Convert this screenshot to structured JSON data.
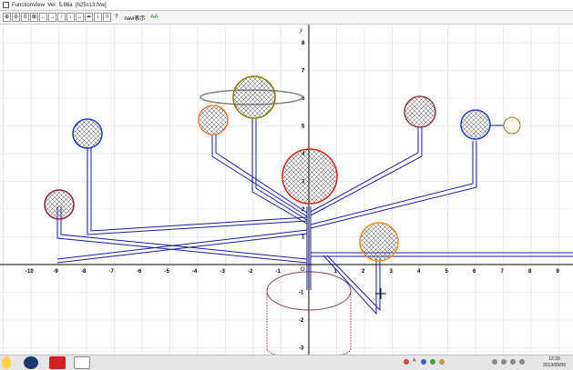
{
  "window": {
    "title": "FunctionView  Ver  5.86a  [h25s13.fvw]"
  },
  "toolbar": {
    "icons": [
      "zoom-in-icon",
      "zoom-out-icon",
      "zero-icon",
      "fit-icon",
      "move-left-icon",
      "move-right-icon",
      "move-up-icon",
      "move-down-icon",
      "expand-h-icon",
      "shrink-h-icon",
      "expand-v-icon",
      "shrink-v-icon"
    ],
    "zero_label": "0",
    "help_label": "?",
    "navi_label": "navi表示",
    "font_label": "AA"
  },
  "graph": {
    "y_axis_label": "y",
    "origin_label": "O",
    "x_tick_labels": [
      "-10",
      "-9",
      "-8",
      "-7",
      "-6",
      "-5",
      "-4",
      "-3",
      "-2",
      "-1",
      "1",
      "2",
      "3",
      "4",
      "5",
      "6",
      "7",
      "8",
      "9"
    ],
    "y_tick_labels": [
      "8",
      "7",
      "6",
      "5",
      "4",
      "3",
      "2",
      "1",
      "-1",
      "-2",
      "-3"
    ],
    "colors": {
      "grid": "#dddddd",
      "axis": "#000000",
      "branch": "#1a1aa0",
      "ring": "#808080"
    },
    "balls": [
      {
        "id": "red-large",
        "color": "#e02020"
      },
      {
        "id": "olive",
        "color": "#808000"
      },
      {
        "id": "orange-upper",
        "color": "#f08040"
      },
      {
        "id": "brown",
        "color": "#904040"
      },
      {
        "id": "blue-right",
        "color": "#2040c0"
      },
      {
        "id": "yellow",
        "color": "#d8c870"
      },
      {
        "id": "blue-left",
        "color": "#2040c0"
      },
      {
        "id": "maroon",
        "color": "#902040"
      },
      {
        "id": "orange-lower",
        "color": "#f09020"
      }
    ],
    "pot_color": "#804060"
  },
  "taskbar": {
    "clock_time": "12:39",
    "clock_date": "2013/09/05",
    "tray_text": "A"
  }
}
